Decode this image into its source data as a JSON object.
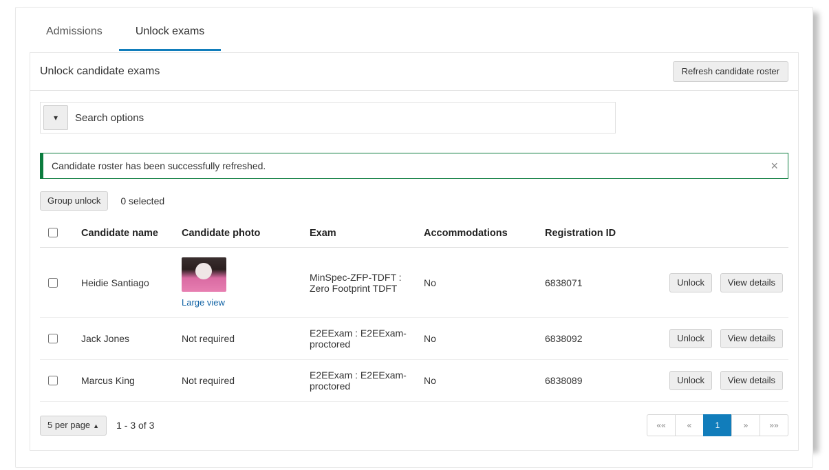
{
  "tabs": [
    {
      "label": "Admissions",
      "active": false
    },
    {
      "label": "Unlock exams",
      "active": true
    }
  ],
  "section": {
    "title": "Unlock candidate exams",
    "refresh_label": "Refresh candidate roster"
  },
  "search": {
    "label": "Search options"
  },
  "alert": {
    "type": "success",
    "message": "Candidate roster has been successfully refreshed."
  },
  "bulk": {
    "group_unlock_label": "Group unlock",
    "selected_label": "0 selected"
  },
  "table": {
    "headers": [
      "Candidate name",
      "Candidate photo",
      "Exam",
      "Accommodations",
      "Registration ID"
    ],
    "action_labels": {
      "unlock": "Unlock",
      "view_details": "View details"
    },
    "rows": [
      {
        "name": "Heidie Santiago",
        "photo_link": "Large view",
        "exam": "MinSpec-ZFP-TDFT : Zero Footprint TDFT",
        "accommodations": "No",
        "registration_id": "6838071"
      },
      {
        "name": "Jack Jones",
        "photo_text": "Not required",
        "exam": "E2EExam : E2EExam-proctored",
        "accommodations": "No",
        "registration_id": "6838092"
      },
      {
        "name": "Marcus King",
        "photo_text": "Not required",
        "exam": "E2EExam : E2EExam-proctored",
        "accommodations": "No",
        "registration_id": "6838089"
      }
    ]
  },
  "footer": {
    "per_page_label": "5 per page",
    "range_label": "1 - 3 of 3",
    "pager": {
      "first": "««",
      "prev": "«",
      "current": "1",
      "next": "»",
      "last": "»»"
    }
  }
}
